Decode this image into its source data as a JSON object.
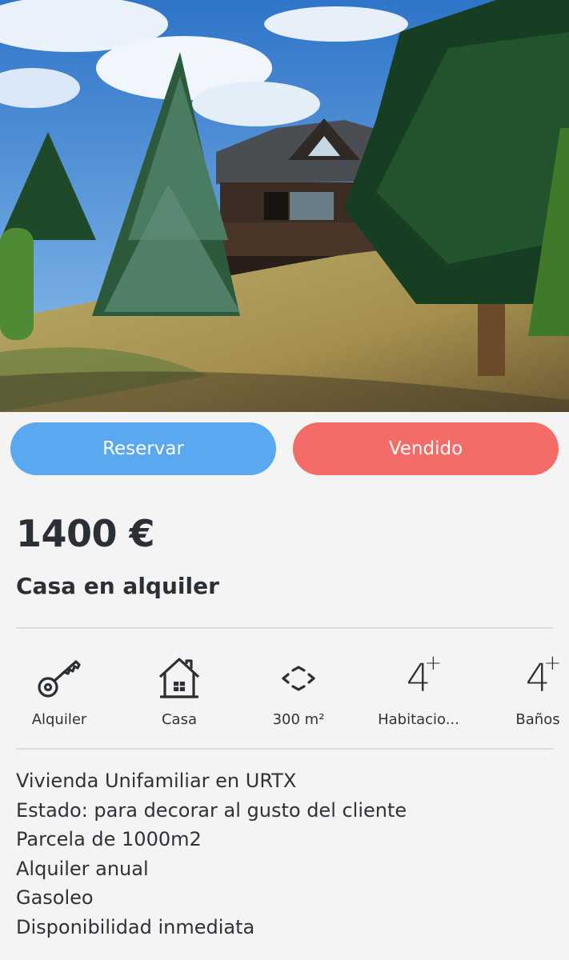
{
  "photo": {
    "alt_name": "house-photo"
  },
  "actions": {
    "reserve_label": "Reservar",
    "sold_label": "Vendido"
  },
  "listing": {
    "price": "1400 €",
    "title": "Casa en alquiler"
  },
  "features": [
    {
      "icon": "key-icon",
      "label": "Alquiler"
    },
    {
      "icon": "house-icon",
      "label": "Casa"
    },
    {
      "icon": "area-icon",
      "label": "300 m²"
    },
    {
      "icon": "bedrooms-icon",
      "value": "4",
      "label": "Habitacio..."
    },
    {
      "icon": "bathrooms-icon",
      "value": "4",
      "label": "Baños"
    }
  ],
  "description": [
    "Vivienda Unifamiliar en URTX",
    "Estado: para decorar al gusto del cliente",
    "Parcela de 1000m2",
    "Alquiler anual",
    "Gasoleo",
    "Disponibilidad inmediata"
  ],
  "colors": {
    "reserve": "#5aa8f0",
    "sold": "#f36c67",
    "text": "#2b3036"
  }
}
